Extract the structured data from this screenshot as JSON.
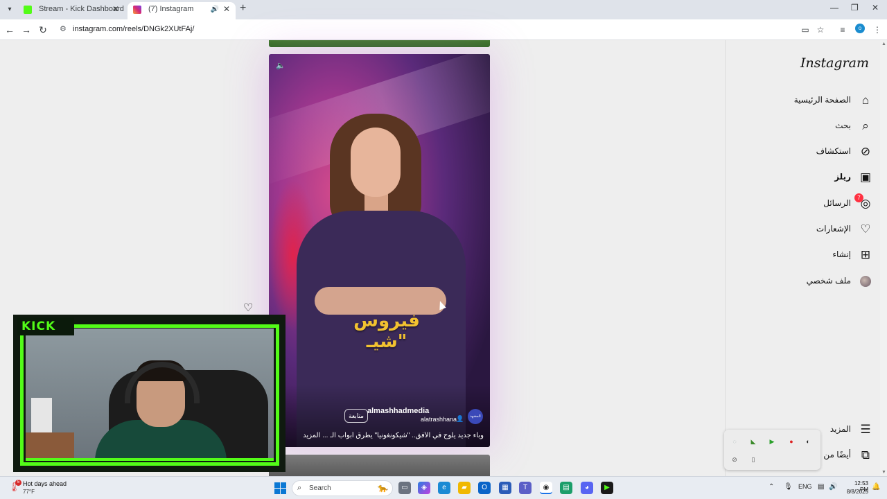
{
  "browser": {
    "tabs": [
      {
        "label": "Stream - Kick Dashboard"
      },
      {
        "label": "(7) Instagram"
      }
    ],
    "address": "instagram.com/reels/DNGk2XUtFAj/",
    "profile_initial": "o"
  },
  "instagram": {
    "logo": "Instagram",
    "nav": [
      {
        "label": "الصفحة الرئيسية",
        "icon": "home-icon"
      },
      {
        "label": "بحث",
        "icon": "search-icon"
      },
      {
        "label": "استكشاف",
        "icon": "compass-icon"
      },
      {
        "label": "ريلز",
        "icon": "reels-icon"
      },
      {
        "label": "الرسائل",
        "icon": "messenger-icon",
        "badge": "7"
      },
      {
        "label": "الإشعارات",
        "icon": "heart-icon"
      },
      {
        "label": "إنشاء",
        "icon": "plus-icon"
      },
      {
        "label": "ملف شخصي",
        "icon": "avatar"
      }
    ],
    "more_label": "المزيد",
    "also_from_label": "أيضًا من"
  },
  "reel": {
    "overlay_text": "فيروس \"شيـ",
    "author": "almashhadmedia",
    "collaborator": "alatrashhana",
    "follow_label": "متابعة",
    "caption": "وباء جديد يلوح في الأفق.. \"شيكونغونيا\" يطرق أبواب الـ ... المزيد",
    "author_avatar_text": "المشهد"
  },
  "stream": {
    "logo": "KICK"
  },
  "taskbar": {
    "weather_title": "Hot days ahead",
    "weather_temp": "77°F",
    "weather_badge": "5",
    "search_placeholder": "Search",
    "language": "ENG",
    "time": "12:53 PM",
    "date": "8/8/2025"
  },
  "colors": {
    "kick_green": "#53fc18",
    "badge_red": "#ff3040",
    "reel_gradient": "#a0378e"
  }
}
